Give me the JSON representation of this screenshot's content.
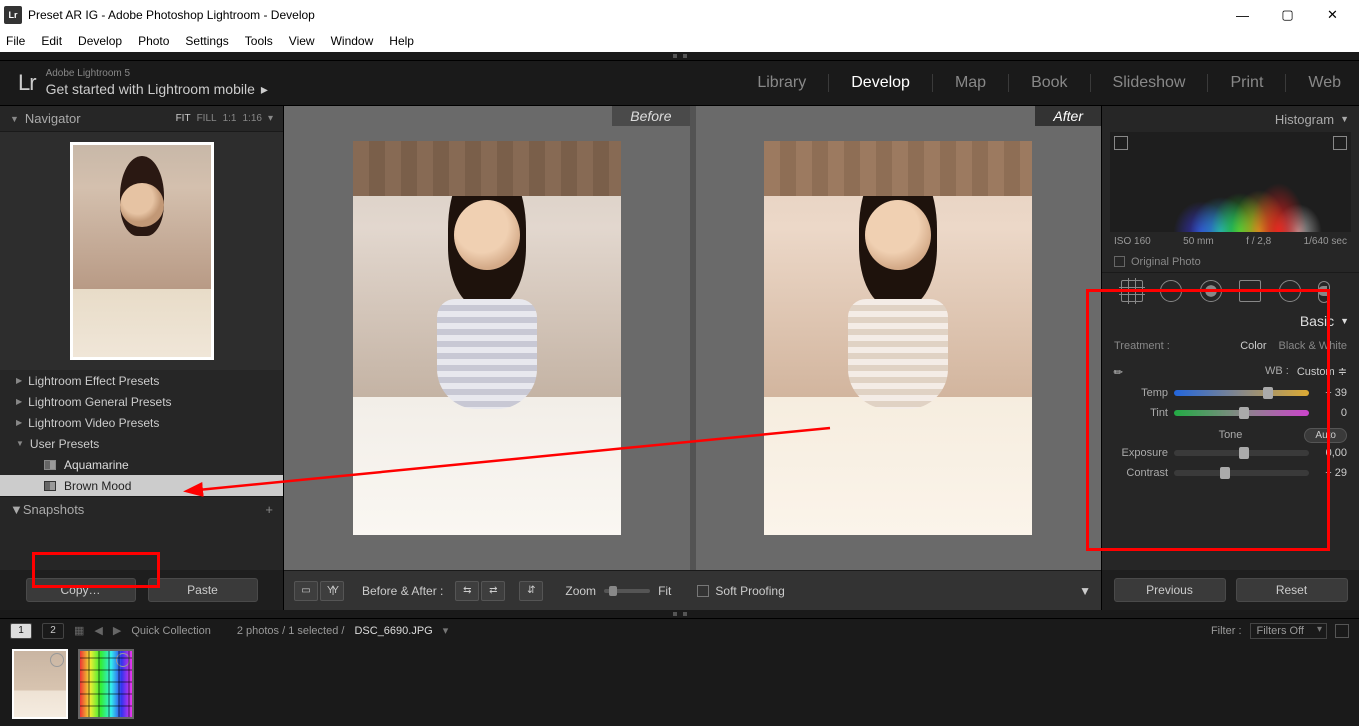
{
  "window": {
    "title": "Preset AR IG - Adobe Photoshop Lightroom - Develop",
    "icon_text": "Lr"
  },
  "menu": [
    "File",
    "Edit",
    "Develop",
    "Photo",
    "Settings",
    "Tools",
    "View",
    "Window",
    "Help"
  ],
  "identity": {
    "logo": "Lr",
    "line1": "Adobe Lightroom 5",
    "line2": "Get started with Lightroom mobile"
  },
  "modules": [
    "Library",
    "Develop",
    "Map",
    "Book",
    "Slideshow",
    "Print",
    "Web"
  ],
  "active_module": "Develop",
  "navigator": {
    "title": "Navigator",
    "zoom": [
      "FIT",
      "FILL",
      "1:1",
      "1:16"
    ],
    "zoom_active": "FIT"
  },
  "presets": {
    "groups": [
      {
        "label": "Lightroom Effect Presets",
        "open": false
      },
      {
        "label": "Lightroom General Presets",
        "open": false
      },
      {
        "label": "Lightroom Video Presets",
        "open": false
      },
      {
        "label": "User Presets",
        "open": true,
        "items": [
          {
            "label": "Aquamarine",
            "selected": false
          },
          {
            "label": "Brown Mood",
            "selected": true
          }
        ]
      }
    ]
  },
  "snapshots": {
    "title": "Snapshots"
  },
  "left_buttons": {
    "copy": "Copy…",
    "paste": "Paste"
  },
  "compare": {
    "before": "Before",
    "after": "After"
  },
  "center_toolbar": {
    "before_after_label": "Before & After :",
    "zoom_label": "Zoom",
    "fit_label": "Fit",
    "soft_proofing": "Soft Proofing"
  },
  "right": {
    "histogram_title": "Histogram",
    "histo_info": [
      "ISO 160",
      "50 mm",
      "f / 2,8",
      "1/640 sec"
    ],
    "original_photo": "Original Photo",
    "basic_title": "Basic",
    "treatment_label": "Treatment :",
    "treatment_color": "Color",
    "treatment_bw": "Black & White",
    "wb_label": "WB :",
    "wb_value": "Custom",
    "temp_label": "Temp",
    "temp_value": "+ 39",
    "tint_label": "Tint",
    "tint_value": "0",
    "tone_label": "Tone",
    "auto_label": "Auto",
    "exposure_label": "Exposure",
    "exposure_value": "0,00",
    "contrast_label": "Contrast",
    "contrast_value": "− 29",
    "previous": "Previous",
    "reset": "Reset"
  },
  "filmstrip": {
    "views": [
      "1",
      "2"
    ],
    "collection": "Quick Collection",
    "count": "2 photos / 1 selected /",
    "file": "DSC_6690.JPG",
    "filter_label": "Filter :",
    "filter_value": "Filters Off"
  }
}
